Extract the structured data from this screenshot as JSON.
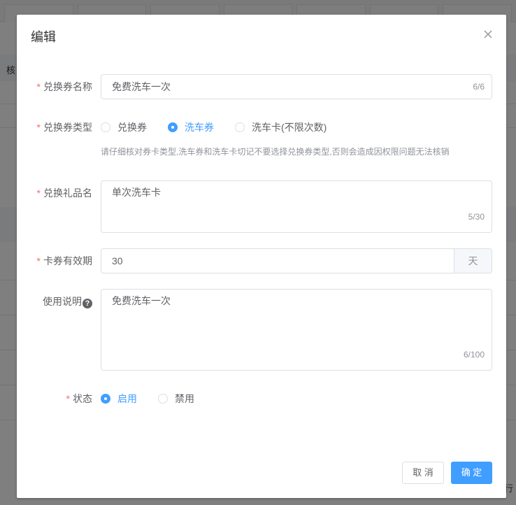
{
  "dialog": {
    "title": "编辑"
  },
  "background": {
    "side_label": "核",
    "corner_text": "行"
  },
  "form": {
    "name": {
      "label": "兑换券名称",
      "value": "免费洗车一次",
      "count": "6/6"
    },
    "type": {
      "label": "兑换券类型",
      "options": [
        "兑换券",
        "洗车券",
        "洗车卡(不限次数)"
      ],
      "selected": "洗车券",
      "hint": "请仔细核对券卡类型,洗车券和洗车卡切记不要选择兑换券类型,否则会造成因权限问题无法核销"
    },
    "gift": {
      "label": "兑换礼品名",
      "value": "单次洗车卡",
      "count": "5/30"
    },
    "validity": {
      "label": "卡券有效期",
      "value": "30",
      "unit": "天"
    },
    "usage": {
      "label": "使用说明",
      "value": "免费洗车一次",
      "count": "6/100"
    },
    "status": {
      "label": "状态",
      "options": [
        "启用",
        "禁用"
      ],
      "selected": "启用"
    }
  },
  "footer": {
    "cancel_label": "取 消",
    "ok_label": "确 定"
  },
  "colors": {
    "primary": "#409eff",
    "required": "#f56c6c",
    "mask": "rgba(0,0,0,0.5)"
  }
}
